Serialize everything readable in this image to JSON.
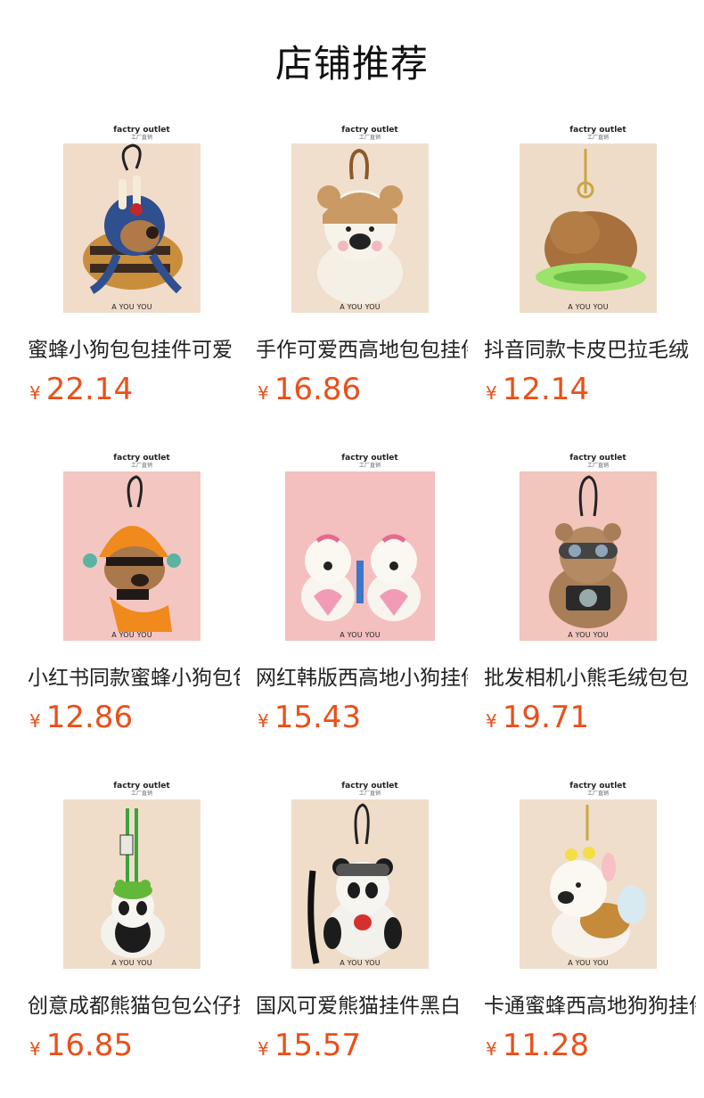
{
  "page_title": "店铺推荐",
  "photo": {
    "brand": "factry outlet",
    "brand_sub": "工厂直销",
    "label": "A YOU YOU"
  },
  "currency": "¥",
  "colors": {
    "price": "#e9501b"
  },
  "products": [
    {
      "name": "蜜蜂小狗包包挂件可爱",
      "price": "22.14",
      "bg": "#f1dcc9",
      "icon": "bee-dog-plush-icon"
    },
    {
      "name": "手作可爱西高地包包挂件",
      "price": "16.86",
      "bg": "#f0dfcd",
      "icon": "bear-hat-westie-plush-icon"
    },
    {
      "name": "抖音同款卡皮巴拉毛绒",
      "price": "12.14",
      "bg": "#efdcc8",
      "icon": "capybara-plush-icon"
    },
    {
      "name": "小红书同款蜜蜂小狗包包",
      "price": "12.86",
      "bg": "#f3c6c2",
      "icon": "bee-dog-plush-icon"
    },
    {
      "name": "网红韩版西高地小狗挂件",
      "price": "15.43",
      "bg": "#f4bfbf",
      "icon": "barbie-westie-pair-icon"
    },
    {
      "name": "批发相机小熊毛绒包包",
      "price": "19.71",
      "bg": "#f2c5bd",
      "icon": "camera-bear-plush-icon"
    },
    {
      "name": "创意成都熊猫包包公仔挂件",
      "price": "16.85",
      "bg": "#f0ddc9",
      "icon": "panda-frog-hat-plush-icon"
    },
    {
      "name": "国风可爱熊猫挂件黑白",
      "price": "15.57",
      "bg": "#efddc9",
      "icon": "panda-goggles-plush-icon"
    },
    {
      "name": "卡通蜜蜂西高地狗狗挂件",
      "price": "11.28",
      "bg": "#efdecb",
      "icon": "bee-westie-plush-icon"
    }
  ]
}
